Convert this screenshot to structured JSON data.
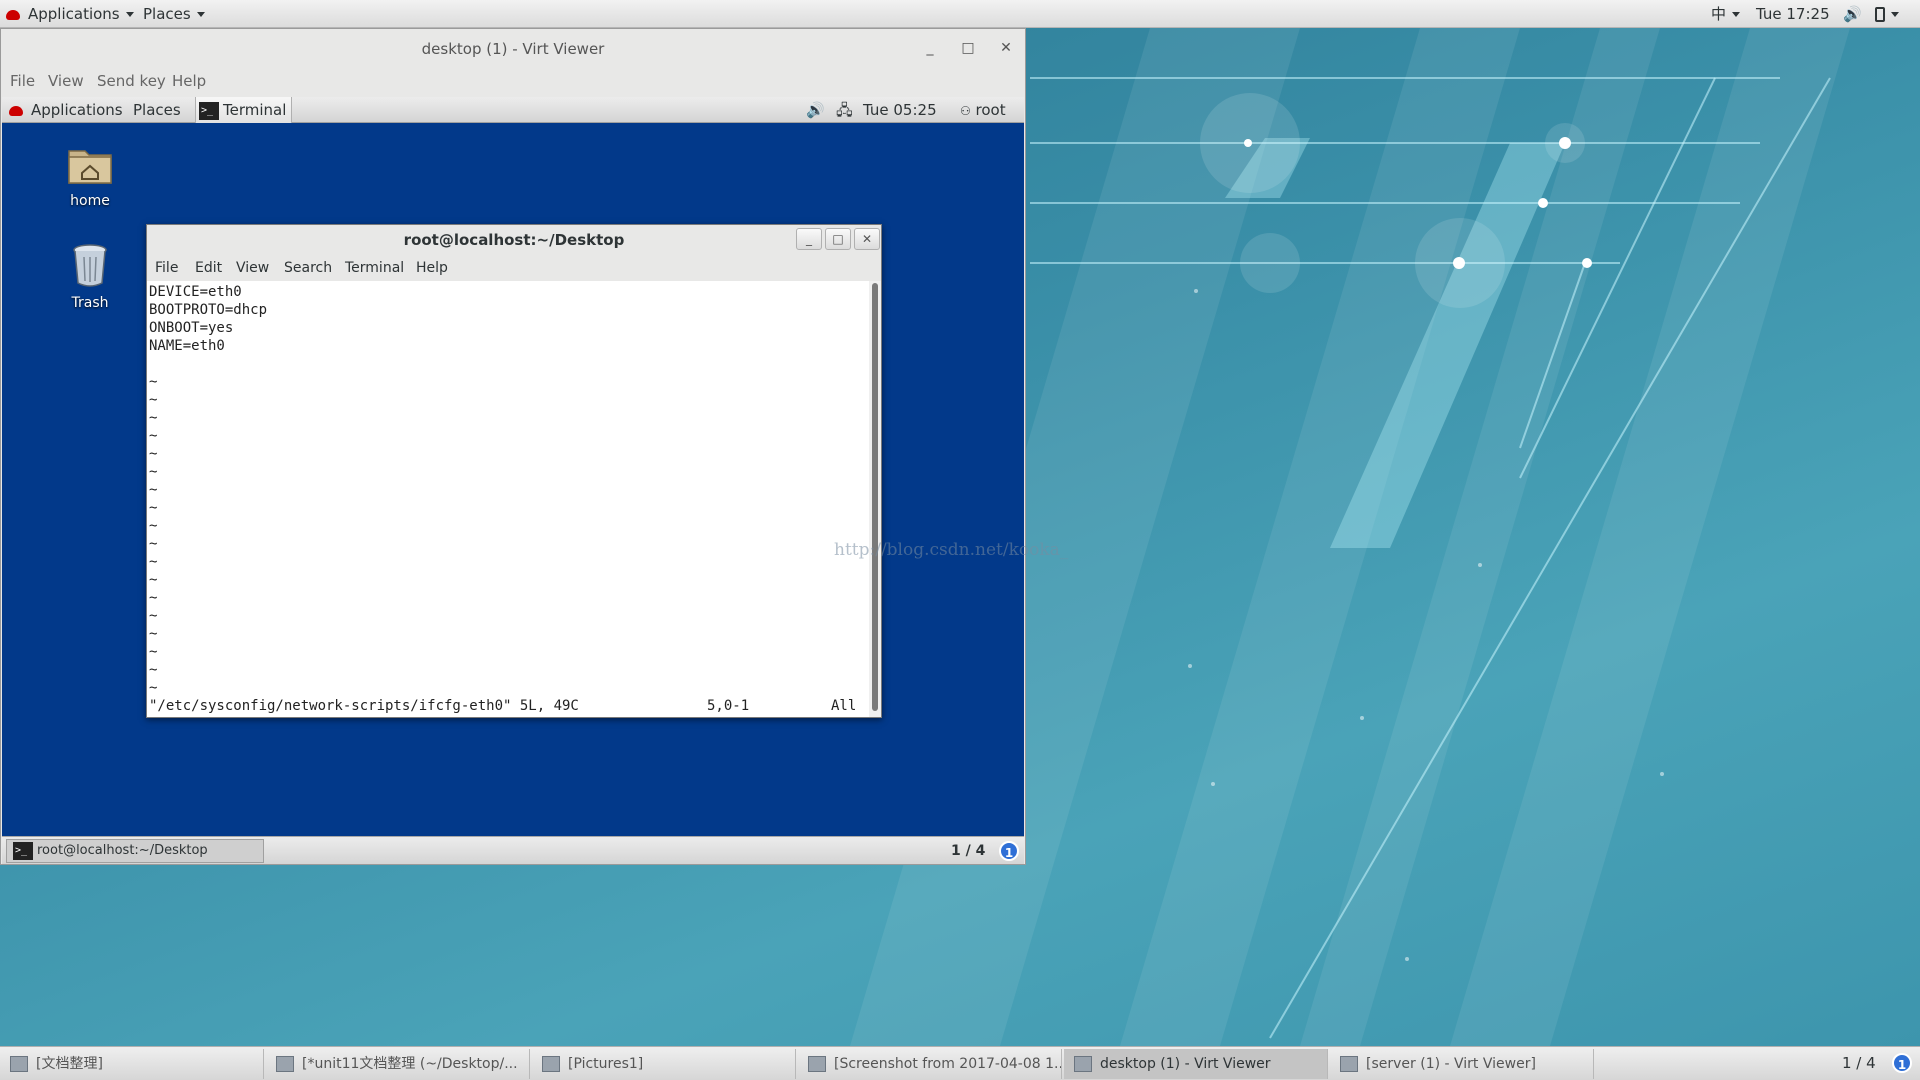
{
  "host_topbar": {
    "applications": "Applications",
    "places": "Places",
    "input_method": "中",
    "clock": "Tue 17:25"
  },
  "virt_viewer": {
    "title": "desktop (1) - Virt Viewer",
    "menu": [
      "File",
      "View",
      "Send key",
      "Help"
    ]
  },
  "guest_topbar": {
    "applications": "Applications",
    "places": "Places",
    "terminal": "Terminal",
    "clock": "Tue 05:25",
    "user": "root"
  },
  "desktop_icons": [
    {
      "label": "home",
      "icon": "home-folder-icon"
    },
    {
      "label": "Trash",
      "icon": "trash-icon"
    }
  ],
  "terminal": {
    "title": "root@localhost:~/Desktop",
    "menu": [
      "File",
      "Edit",
      "View",
      "Search",
      "Terminal",
      "Help"
    ],
    "lines": [
      "DEVICE=eth0",
      "BOOTPROTO=dhcp",
      "ONBOOT=yes",
      "NAME=eth0",
      ""
    ],
    "tilde_lines": 18,
    "status_file": "\"/etc/sysconfig/network-scripts/ifcfg-eth0\" 5L, 49C",
    "status_pos": "5,0-1",
    "status_all": "All"
  },
  "guest_bottom": {
    "task": "root@localhost:~/Desktop",
    "workspace": "1 / 4",
    "badge": "1"
  },
  "host_bottom": {
    "tasks": [
      {
        "label": "[文档整理]",
        "active": false
      },
      {
        "label": "[*unit11文档整理 (~/Desktop/...",
        "active": false
      },
      {
        "label": "[Pictures1]",
        "active": false
      },
      {
        "label": "[Screenshot from 2017-04-08 1...",
        "active": false
      },
      {
        "label": "desktop (1) - Virt Viewer",
        "active": true
      },
      {
        "label": "[server (1) - Virt Viewer]",
        "active": false
      }
    ],
    "workspace": "1 / 4",
    "badge": "1"
  },
  "watermark": "http://blog.csdn.net/kooka_",
  "colors": {
    "guest_desktop": "#02398a",
    "host_desktop": "#3a8ea6",
    "active_accent": "#2f6fd6"
  }
}
